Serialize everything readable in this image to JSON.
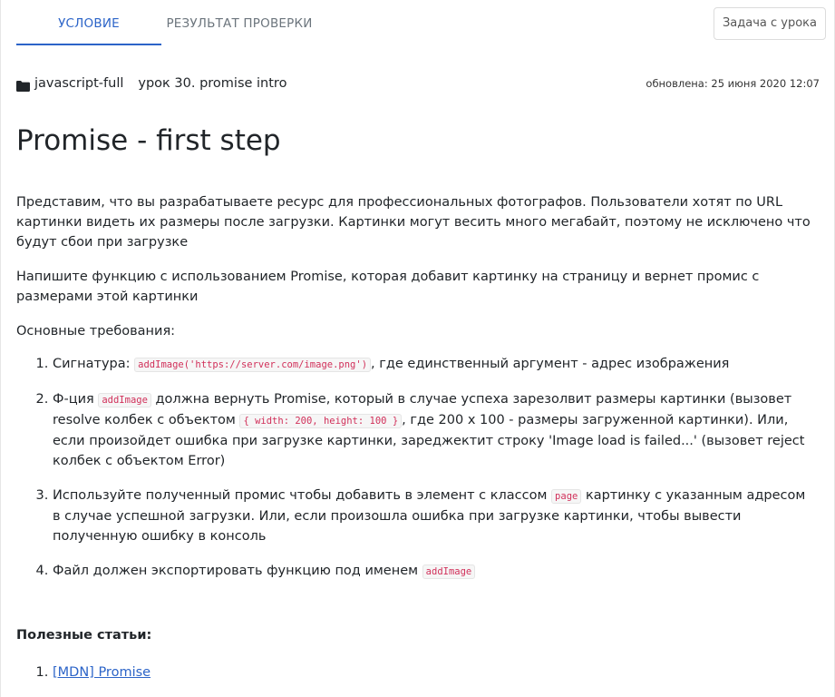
{
  "tabs": [
    {
      "label": "УСЛОВИЕ",
      "active": true
    },
    {
      "label": "РЕЗУЛЬТАТ ПРОВЕРКИ",
      "active": false
    }
  ],
  "task_button": "Задача с урока",
  "meta": {
    "folder_icon": "folder-icon",
    "course": "javascript-full",
    "lesson": "урок 30. promise intro",
    "updated": "обновлена: 25 июня 2020 12:07"
  },
  "title": "Promise - first step",
  "paragraphs": {
    "p1": "Представим, что вы разрабатываете ресурс для профессиональных фотографов. Пользователи хотят по URL картинки видеть их размеры после загрузки. Картинки могут весить много мегабайт, поэтому не исключено что будут сбои при загрузке",
    "p2": "Напишите функцию с использованием Promise, которая добавит картинку на страницу и вернет промис с размерами этой картинки",
    "p3": "Основные требования:"
  },
  "requirements": {
    "r1": {
      "t1": "Сигнатура: ",
      "c1": "addImage('https://server.com/image.png')",
      "t2": ", где единственный аргумент - адрес изображения"
    },
    "r2": {
      "t1": "Ф-ция ",
      "c1": "addImage",
      "t2": " должна вернуть Promise, который в случае успеха зарезолвит размеры картинки (вызовет resolve колбек с объектом ",
      "c2": "{ width: 200, height: 100 }",
      "t3": ", где 200 x 100 - размеры загруженной картинки). Или, если произойдет ошибка при загрузке картинки, зареджектит строку 'Image load is failed...' (вызовет reject колбек с объектом Error)"
    },
    "r3": {
      "t1": "Используйте полученный промис чтобы добавить в элемент с классом ",
      "c1": "page",
      "t2": " картинку с указанным адресом в случае успешной загрузки. Или, если произошла ошибка при загрузке картинки, чтобы вывести полученную ошибку в консоль"
    },
    "r4": {
      "t1": "Файл должен экспортировать функцию под именем ",
      "c1": "addImage"
    }
  },
  "useful": {
    "heading": "Полезные статьи:",
    "links": [
      "[MDN] Promise"
    ]
  },
  "colors": {
    "accent": "#2c64c8",
    "code_text": "#d1305a",
    "muted_tab": "#6c757d"
  }
}
